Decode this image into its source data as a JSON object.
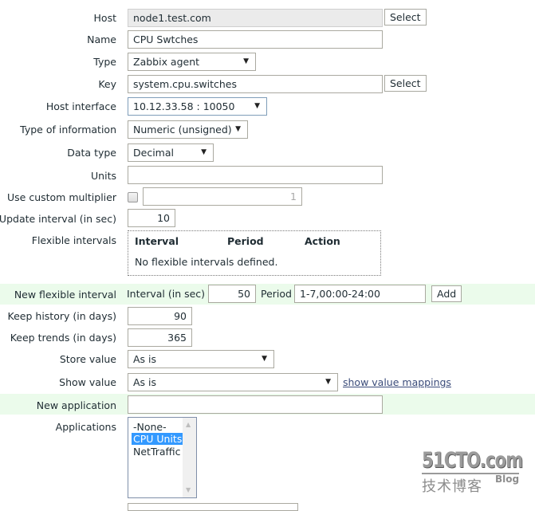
{
  "form": {
    "host": {
      "label": "Host",
      "value": "node1.test.com",
      "select_label": "Select"
    },
    "name": {
      "label": "Name",
      "value": "CPU Swtches"
    },
    "type": {
      "label": "Type",
      "value": "Zabbix agent"
    },
    "key": {
      "label": "Key",
      "value": "system.cpu.switches",
      "select_label": "Select"
    },
    "host_interface": {
      "label": "Host interface",
      "value": "10.12.33.58 : 10050"
    },
    "type_of_information": {
      "label": "Type of information",
      "value": "Numeric (unsigned)"
    },
    "data_type": {
      "label": "Data type",
      "value": "Decimal"
    },
    "units": {
      "label": "Units",
      "value": ""
    },
    "custom_multiplier": {
      "label": "Use custom multiplier",
      "checked": false,
      "value": "1"
    },
    "update_interval": {
      "label": "Update interval (in sec)",
      "value": "10"
    },
    "flexible_intervals": {
      "label": "Flexible intervals",
      "columns": [
        "Interval",
        "Period",
        "Action"
      ],
      "empty_text": "No flexible intervals defined."
    },
    "new_flexible_interval": {
      "label": "New flexible interval",
      "interval_label": "Interval (in sec)",
      "interval_value": "50",
      "period_label": "Period",
      "period_value": "1-7,00:00-24:00",
      "add_label": "Add"
    },
    "keep_history": {
      "label": "Keep history (in days)",
      "value": "90"
    },
    "keep_trends": {
      "label": "Keep trends (in days)",
      "value": "365"
    },
    "store_value": {
      "label": "Store value",
      "value": "As is"
    },
    "show_value": {
      "label": "Show value",
      "value": "As is",
      "link": "show value mappings"
    },
    "new_application": {
      "label": "New application",
      "value": ""
    },
    "applications": {
      "label": "Applications",
      "options": [
        "-None-",
        "CPU Units",
        "NetTraffic"
      ],
      "selected": "CPU Units"
    }
  },
  "watermark": {
    "brand": "51CTO.com",
    "subtitle": "技术博客",
    "tag": "Blog"
  },
  "icons": {
    "dropdown": "▼",
    "scroll_up": "▲",
    "scroll_down": "▼"
  },
  "colors": {
    "highlight_row": "#ebfbeb",
    "selection": "#3399ff",
    "link": "#3b4c7a"
  }
}
